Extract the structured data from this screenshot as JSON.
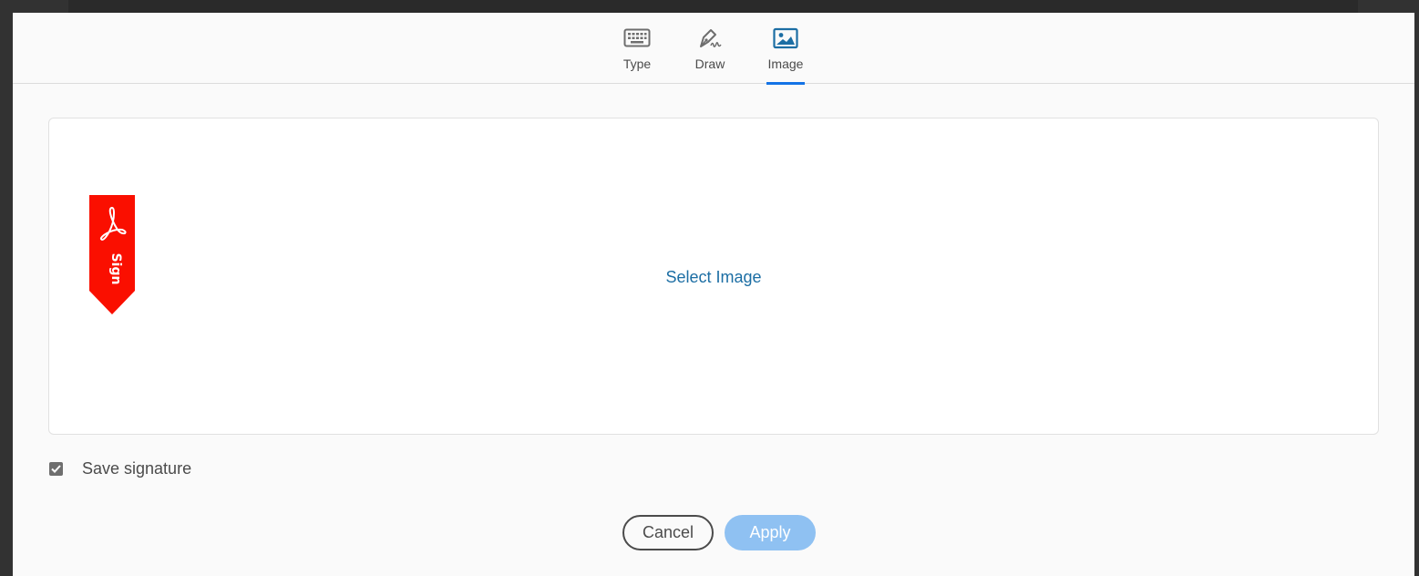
{
  "tabs": [
    {
      "label": "Type",
      "icon": "keyboard-icon",
      "active": false
    },
    {
      "label": "Draw",
      "icon": "pen-icon",
      "active": false
    },
    {
      "label": "Image",
      "icon": "image-icon",
      "active": true
    }
  ],
  "drop_area": {
    "select_image_label": "Select Image",
    "badge_text": "Sign",
    "badge_color": "#fa0f00"
  },
  "save_signature": {
    "label": "Save signature",
    "checked": true
  },
  "actions": {
    "cancel_label": "Cancel",
    "apply_label": "Apply"
  },
  "colors": {
    "accent": "#1473e6",
    "link": "#1c6ea4",
    "apply_disabled": "#8fc1f2"
  }
}
